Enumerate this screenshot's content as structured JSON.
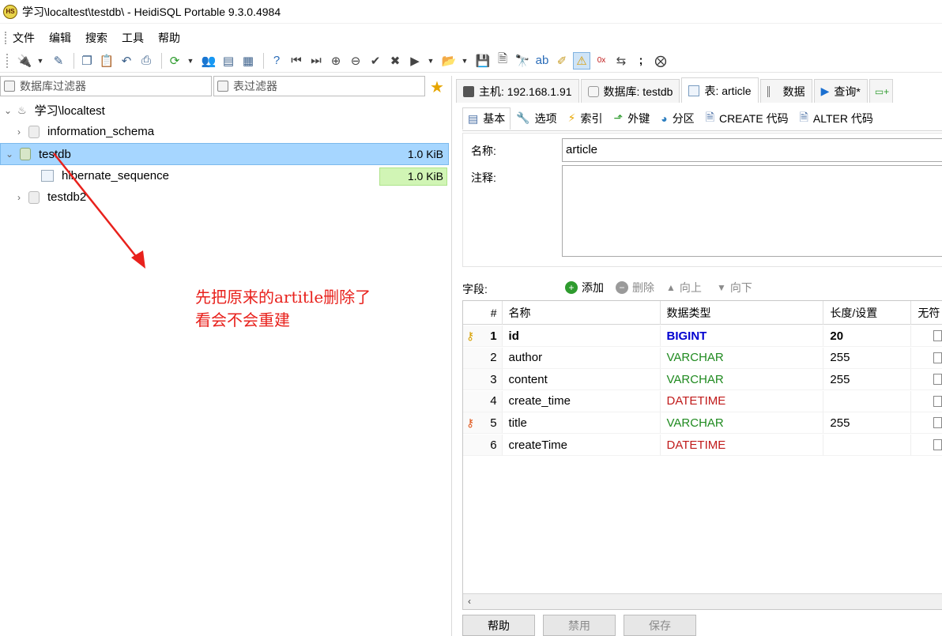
{
  "window": {
    "title": "学习\\localtest\\testdb\\ - HeidiSQL Portable 9.3.0.4984",
    "icon_text": "HS"
  },
  "menu": [
    "文件",
    "编辑",
    "搜索",
    "工具",
    "帮助"
  ],
  "left": {
    "db_filter_placeholder": "数据库过滤器",
    "table_filter_placeholder": "表过滤器",
    "tree": {
      "root": "学习\\localtest",
      "items": [
        {
          "name": "information_schema",
          "size": ""
        },
        {
          "name": "testdb",
          "size": "1.0 KiB"
        },
        {
          "name": "hibernate_sequence",
          "size": "1.0 KiB"
        },
        {
          "name": "testdb2",
          "size": ""
        }
      ]
    },
    "annotation": [
      "先把原来的artitle删除了",
      "看会不会重建"
    ],
    "annotation_color": "#e8211c"
  },
  "tabs": [
    "主机: 192.168.1.91",
    "数据库: testdb",
    "表: article",
    "数据",
    "查询*"
  ],
  "subtabs": [
    "基本",
    "选项",
    "索引",
    "外键",
    "分区",
    "CREATE 代码",
    "ALTER 代码"
  ],
  "basic": {
    "name_label": "名称:",
    "name_value": "article",
    "comment_label": "注释:"
  },
  "fields": {
    "label": "字段:",
    "add": "添加",
    "delete": "删除",
    "up": "向上",
    "down": "向下",
    "headers": [
      "#",
      "名称",
      "数据类型",
      "长度/设置",
      "无符"
    ],
    "rows": [
      {
        "num": "1",
        "name": "id",
        "type": "BIGINT",
        "length": "20",
        "key": "primary"
      },
      {
        "num": "2",
        "name": "author",
        "type": "VARCHAR",
        "length": "255",
        "key": ""
      },
      {
        "num": "3",
        "name": "content",
        "type": "VARCHAR",
        "length": "255",
        "key": ""
      },
      {
        "num": "4",
        "name": "create_time",
        "type": "DATETIME",
        "length": "",
        "key": ""
      },
      {
        "num": "5",
        "name": "title",
        "type": "VARCHAR",
        "length": "255",
        "key": "unique"
      },
      {
        "num": "6",
        "name": "createTime",
        "type": "DATETIME",
        "length": "",
        "key": ""
      }
    ],
    "type_colors": {
      "BIGINT": "#0000d0",
      "VARCHAR": "#1f8a1f",
      "DATETIME": "#c01a1a"
    }
  },
  "buttons": {
    "help": "帮助",
    "discard": "禁用",
    "save": "保存"
  }
}
